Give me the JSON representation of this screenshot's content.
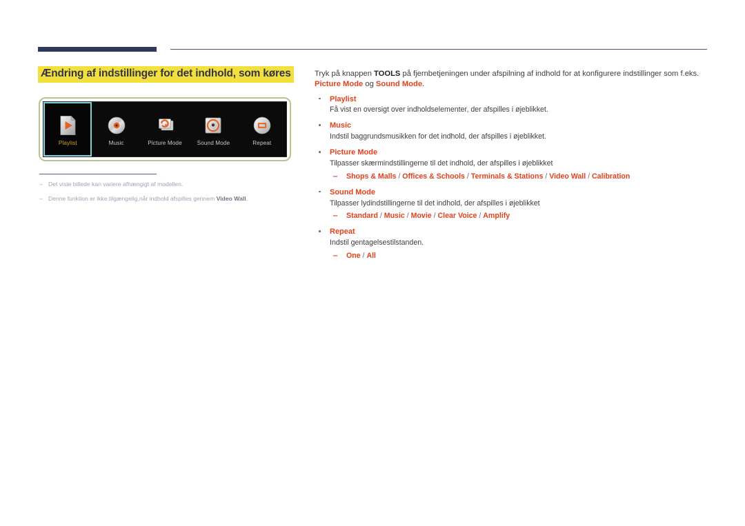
{
  "section": {
    "title": "Ændring af indstillinger for det indhold, som køres"
  },
  "colors": {
    "highlight_yellow": "#f2e03c",
    "accent_red": "#e2401c",
    "rule_navy": "#2e3a5c",
    "panel_border_green": "#b4c48e",
    "selected_border_cyan": "#7fd2d8",
    "selected_label_gold": "#d8a427",
    "note_gray": "#9ea3b8"
  },
  "device_panel": {
    "tiles": [
      {
        "label": "Playlist",
        "icon": "playlist-file-play-icon",
        "selected": true
      },
      {
        "label": "Music",
        "icon": "music-disc-icon",
        "selected": false
      },
      {
        "label": "Picture Mode",
        "icon": "picture-mode-refresh-icon",
        "selected": false
      },
      {
        "label": "Sound Mode",
        "icon": "sound-mode-speaker-icon",
        "selected": false
      },
      {
        "label": "Repeat",
        "icon": "repeat-loop-icon",
        "selected": false
      }
    ]
  },
  "notes": [
    {
      "dash": "‒",
      "text": "Det viste billede kan variere afhængigt af modellen.",
      "bold": "",
      "tail": ""
    },
    {
      "dash": "‒",
      "text": "Denne funktion er ikke tilgængelig,når indhold afspilles gennem ",
      "bold": "Video Wall",
      "tail": "."
    }
  ],
  "content": {
    "intro": {
      "part1": "Tryk på knappen ",
      "kbd": "TOOLS",
      "part2": " på fjernbetjeningen under afspilning af indhold for at konfigurere indstillinger som f.eks. ",
      "hl1": "Picture Mode",
      "part3": " og ",
      "hl2": "Sound Mode",
      "part4": "."
    },
    "items": [
      {
        "title": "Playlist",
        "desc": "Få vist en oversigt over indholdselementer, der afspilles i øjeblikket.",
        "options": []
      },
      {
        "title": "Music",
        "desc": "Indstil baggrundsmusikken for det indhold, der afspilles i øjeblikket.",
        "options": []
      },
      {
        "title": "Picture Mode",
        "desc": "Tilpasser skærmindstillingerne til det indhold, der afspilles i øjeblikket",
        "dash": "‒",
        "options": [
          "Shops & Malls",
          "Offices & Schools",
          "Terminals & Stations",
          "Video Wall",
          "Calibration"
        ]
      },
      {
        "title": "Sound Mode",
        "desc": "Tilpasser lydindstillingerne til det indhold, der afspilles i øjeblikket",
        "dash": "‒",
        "options": [
          "Standard",
          "Music",
          "Movie",
          "Clear Voice",
          "Amplify"
        ]
      },
      {
        "title": "Repeat",
        "desc": "Indstil gentagelsestilstanden.",
        "dash": "‒",
        "options": [
          "One",
          "All"
        ]
      }
    ]
  }
}
